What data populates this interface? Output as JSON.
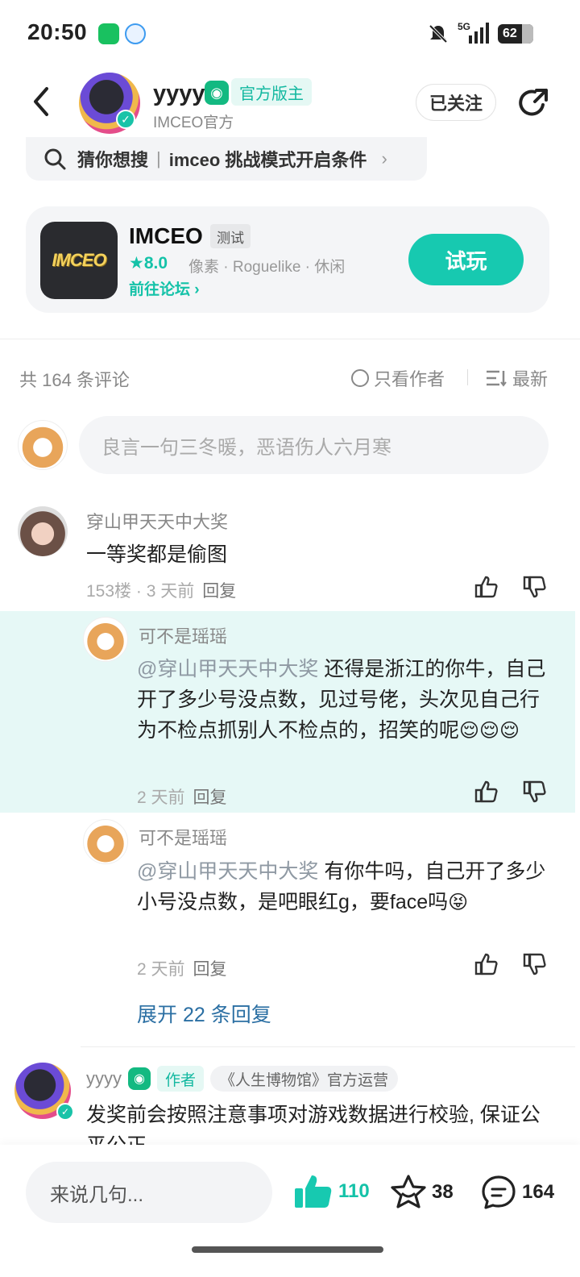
{
  "status_bar": {
    "time": "20:50",
    "network": "5G",
    "battery": "62",
    "apps": [
      "wechat-icon",
      "qq-icon"
    ]
  },
  "header": {
    "username": "yyyy",
    "official_tag": "官方版主",
    "subtitle": "IMCEO官方",
    "follow_label": "已关注"
  },
  "search": {
    "guess_label": "猜你想搜",
    "query": "imceo 挑战模式开启条件"
  },
  "game_card": {
    "icon_text": "IMCEO",
    "title": "IMCEO",
    "tag": "测试",
    "rating": "8.0",
    "genres": "像素 · Roguelike · 休闲",
    "forum_link": "前往论坛",
    "play_label": "试玩"
  },
  "comments_header": {
    "count_label": "共 164 条评论",
    "author_only": "只看作者",
    "sort": "最新"
  },
  "comment_input": {
    "placeholder": "良言一句三冬暖，恶语伤人六月寒"
  },
  "comments": [
    {
      "nick": "穿山甲天天中大奖",
      "text": "一等奖都是偷图",
      "meta": "153楼 · 3 天前",
      "reply_label": "回复",
      "replies": [
        {
          "nick": "可不是瑶瑶",
          "mention": "@穿山甲天天中大奖",
          "text": "还得是浙江的你牛，自己开了多少号没点数，见过号佬，头次见自己行为不检点抓别人不检点的，招笑的呢",
          "emoji": "😌😌😌",
          "meta": "2 天前",
          "reply_label": "回复"
        },
        {
          "nick": "可不是瑶瑶",
          "mention": "@穿山甲天天中大奖",
          "text": "有你牛吗，自己开了多少小号没点数，是吧眼红g，要face吗",
          "emoji": "😝",
          "meta": "2 天前",
          "reply_label": "回复"
        }
      ],
      "expand_label": "展开 22 条回复"
    },
    {
      "nick": "yyyy",
      "author_tag": "作者",
      "ops_tag": "《人生博物馆》官方运营",
      "text": "发奖前会按照注意事项对游戏数据进行校验, 保证公平公正"
    }
  ],
  "bottom_bar": {
    "input_placeholder": "来说几句...",
    "like_count": "110",
    "star_count": "38",
    "comment_count": "164"
  },
  "colors": {
    "accent": "#17c9b0",
    "highlight": "#e6f8f6",
    "link": "#2b6fa3"
  }
}
